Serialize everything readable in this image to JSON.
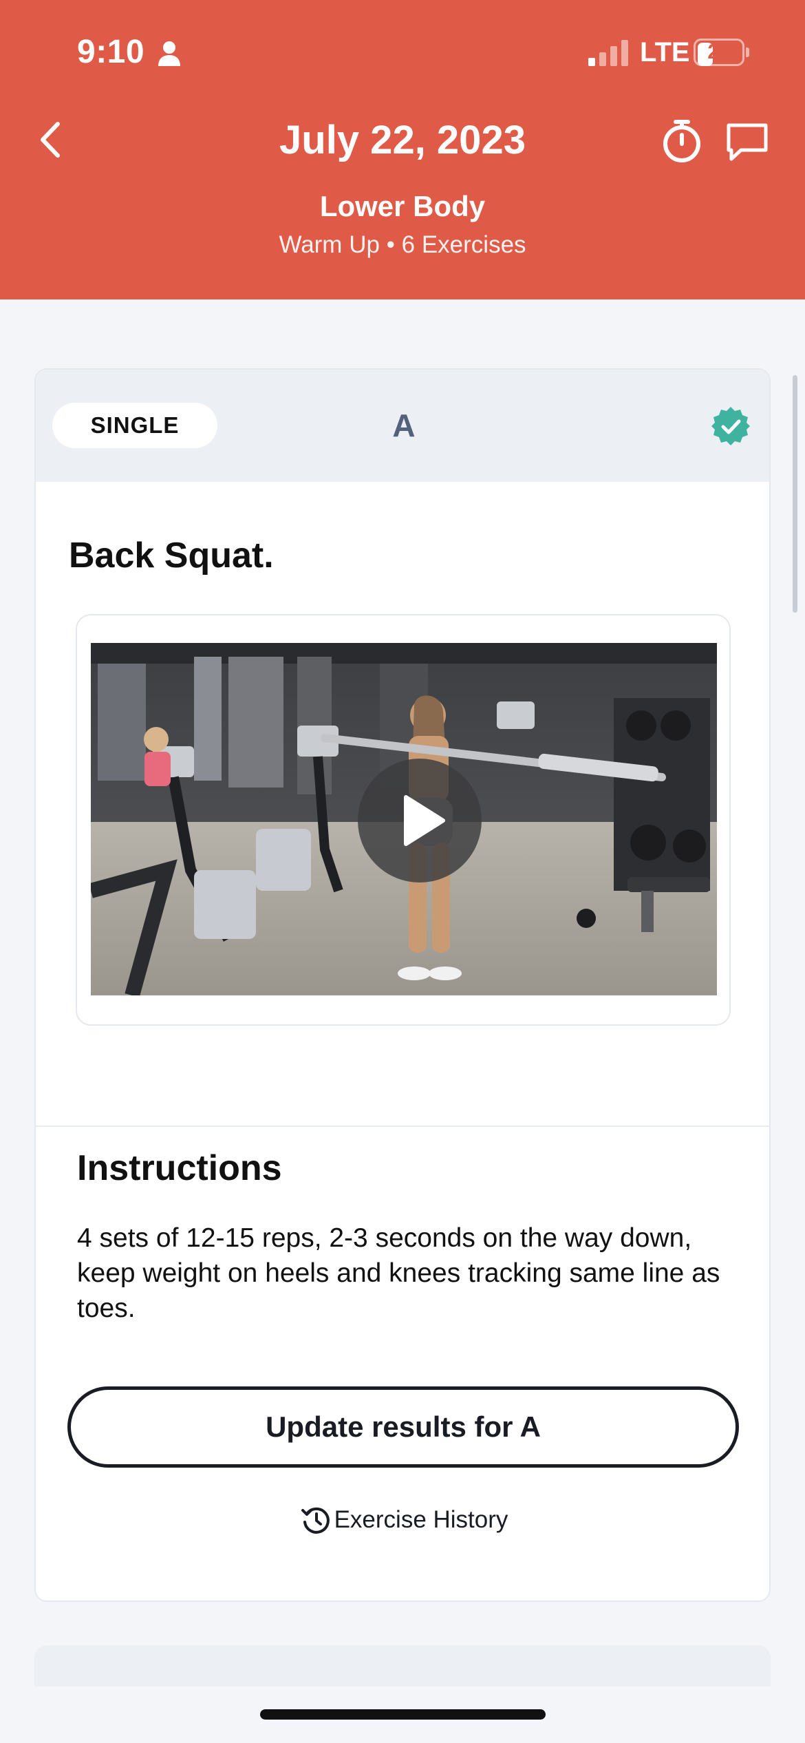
{
  "status_bar": {
    "time": "9:10",
    "network": "LTE",
    "battery": "26"
  },
  "header": {
    "title": "July 22, 2023",
    "subtitle": "Lower Body",
    "meta": "Warm Up • 6 Exercises",
    "icons": [
      "back-arrow-icon",
      "stopwatch-icon",
      "chat-bubble-icon"
    ]
  },
  "exercise_card": {
    "type_label": "SINGLE",
    "letter": "A",
    "completed": true,
    "name": "Back Squat.",
    "instructions_title": "Instructions",
    "instructions": "4 sets of 12-15 reps, 2-3 seconds on the way down, keep weight on heels and knees tracking same line as toes.",
    "update_button": "Update results for A",
    "history_link": "Exercise History"
  },
  "colors": {
    "accent": "#e05a48",
    "success": "#3fb3a0",
    "letter": "#55607a"
  }
}
